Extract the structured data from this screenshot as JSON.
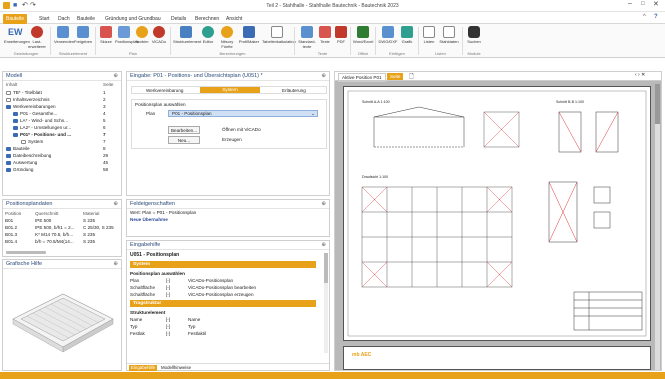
{
  "window": {
    "title": "Teil 2 - Stahlhalle - Stahlhalle Bautechnik - Bautechnik 2023"
  },
  "tabs": [
    "Bauteile",
    "Start",
    "Dach",
    "Bauteile",
    "Gründung und Grundbau",
    "Details",
    "Berechnen",
    "Ansicht"
  ],
  "ribbon": {
    "buttons": [
      "Erweiterungen",
      "Last-erweiterer",
      "Verwenden",
      "Freigeben",
      "Skizze",
      "Positionsplan",
      "Norbim",
      "ViCADo",
      "Strukturelement",
      "Editor",
      "Nitsory Fünfte",
      "ProfilMaker",
      "Tabellenkalkulation",
      "Standard-texte",
      "Texte",
      "PDF",
      "Word/Excel",
      "DWG/DXF",
      "Grafik",
      "Listen",
      "Stahldaten",
      "Suchen"
    ],
    "groups": [
      "Gewindungen",
      "Strukturelement",
      "Plan",
      "Berechnungen",
      "Texte",
      "Office",
      "Einfügen",
      "Listen",
      "Module"
    ]
  },
  "model": {
    "title": "Modell",
    "col_label": "Inhalt",
    "col_count": "Seite",
    "items": [
      {
        "label": "TB* - Titelblatt",
        "count": "1"
      },
      {
        "label": "Inhaltsverzeichnis",
        "count": "2"
      },
      {
        "label": "Werkvereinbarungen",
        "count": "3"
      },
      {
        "label": "P01 - Gesamthe...",
        "count": "4"
      },
      {
        "label": "LA* - Wind- und Schn...",
        "count": "5"
      },
      {
        "label": "LA2* - Umstellungen ur...",
        "count": "6"
      },
      {
        "label": "P01* - Positions- und ...",
        "count": "7"
      },
      {
        "label": "System",
        "count": "7"
      },
      {
        "label": "Bauteile",
        "count": "8"
      },
      {
        "label": "Dateibeschreibung",
        "count": "29"
      },
      {
        "label": "Auswertung",
        "count": "45"
      },
      {
        "label": "Gründung",
        "count": "58"
      }
    ]
  },
  "positions": {
    "title": "Positionsplandaten",
    "headers": [
      "Position",
      "Querschnitt",
      "Material"
    ],
    "rows": [
      [
        "B01",
        "IPE 500",
        "S 235"
      ],
      [
        "B01.2",
        "IPE 500, b/h1 = 2...",
        "C 25/30, S 235"
      ],
      [
        "B01.3",
        "K* M14 70.5, b/h...",
        "S 235"
      ],
      [
        "B01.4",
        "b/h = 70.5/M4(14...",
        "S 235"
      ]
    ]
  },
  "graphics": {
    "title": "Grafische Hilfe"
  },
  "main": {
    "title": "Eingabe: P01 - Positions- und Übersichtsplan (U051) *",
    "subtabs": [
      "Werkvereinbarung",
      "System",
      "Erläuterung"
    ],
    "group_label": "Positionsplan auswählen",
    "plan_label": "Plan",
    "plan_value": "P01 - Positionsplan",
    "btn_edit": "Bearbeiten...",
    "btn_edit_desc": "Öffnen mit ViCADo",
    "btn_new": "Neu...",
    "btn_new_desc": "Erzeugen"
  },
  "fields": {
    "title": "Feldeigenschaften",
    "line1": "Wert: Plan = P01 - Positionsplan",
    "line2": "Neue Übernahme"
  },
  "help": {
    "title": "Eingabehilfe",
    "heading": "U051 - Positionsplan",
    "sec1": "System",
    "sub1": "Positionsplan auswählen",
    "rows1": [
      [
        "Plan",
        "[-]",
        "ViCADo-Positionsplan"
      ],
      [
        "Schaltfläche",
        "[-]",
        "ViCADo-Positionsplan bearbeiten"
      ],
      [
        "Schaltfläche",
        "[-]",
        "ViCADo-Positionsplan erzeugen"
      ]
    ],
    "sec2": "Tragstruktur",
    "sub2": "Strukturelement",
    "rows2": [
      [
        "Name",
        "[-]",
        "Name"
      ],
      [
        "Typ",
        "[-]",
        "Typ"
      ],
      [
        "Festlak",
        "[-]",
        "Festlaktil"
      ]
    ],
    "tab_a": "Eingabehilfe",
    "tab_b": "Modellhinweise"
  },
  "doc": {
    "tabs": [
      "Aktive Position P01",
      "Seite"
    ],
    "drawing_labels": [
      "Schnitt A-A 1:100",
      "Schnitt B-B 1:100",
      "Draufsicht 1:100"
    ],
    "footer_logo": "mb AEC"
  },
  "colors": {
    "accent": "#e8a21a",
    "brand": "#3b6bb4"
  }
}
